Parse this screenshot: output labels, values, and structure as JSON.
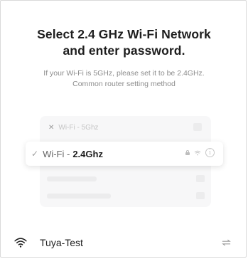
{
  "header": {
    "title_line1": "Select 2.4 GHz Wi-Fi Network",
    "title_line2": "and enter password."
  },
  "hint": {
    "line1": "If your Wi-Fi is 5GHz, please set it to be 2.4GHz.",
    "line2": "Common router setting method"
  },
  "illustration": {
    "network_5g": {
      "prefix": "Wi-Fi - ",
      "band": "5Ghz",
      "status_icon": "x-icon"
    },
    "network_24g": {
      "prefix": "Wi-Fi - ",
      "band": "2.4Ghz",
      "status_icon": "check-icon",
      "icons": [
        "lock-icon",
        "wifi-icon",
        "info-icon"
      ]
    }
  },
  "selected_network": {
    "name": "Tuya-Test",
    "icon": "wifi-icon",
    "action_icon": "switch-network-icon"
  },
  "colors": {
    "text_primary": "#1e1e1e",
    "text_muted": "#8c8c8c",
    "placeholder": "#ececed"
  }
}
